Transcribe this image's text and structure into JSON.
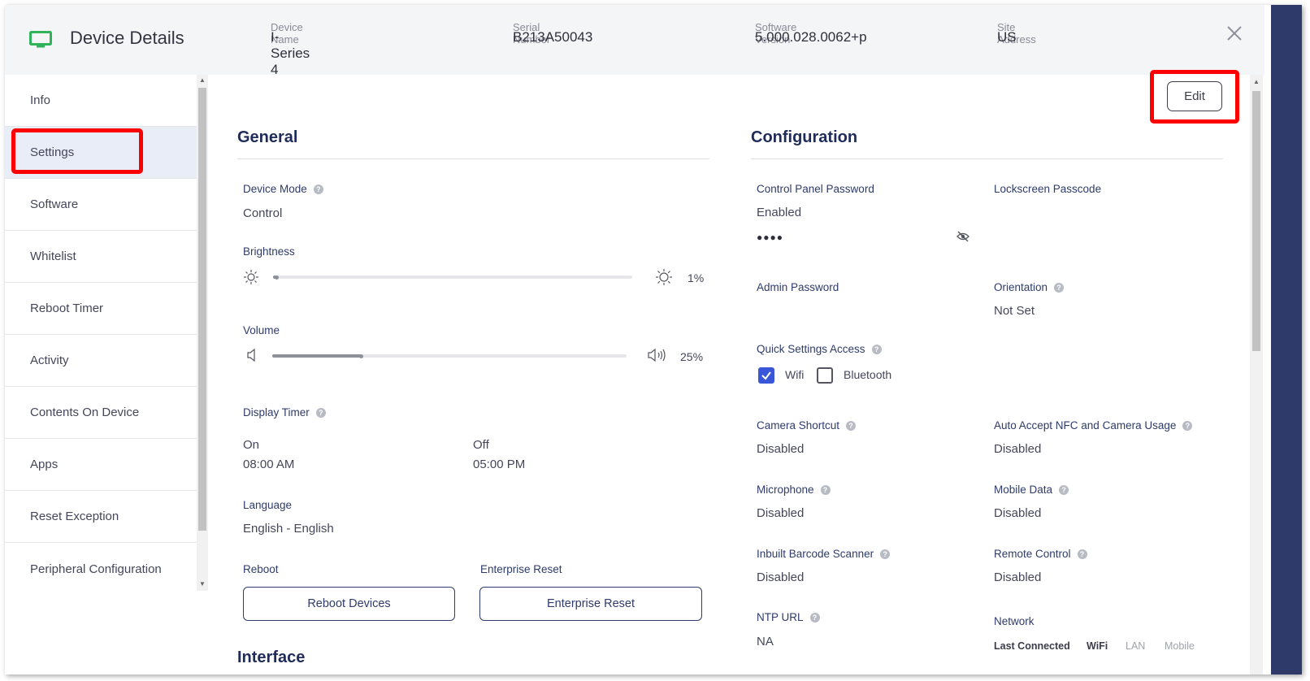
{
  "header": {
    "title": "Device Details",
    "fields": [
      {
        "label": "Device Name",
        "value": "I-Series 4"
      },
      {
        "label": "Serial Number",
        "value": "B213A50043"
      },
      {
        "label": "Software Version",
        "value": "5.000.028.0062+p"
      },
      {
        "label": "Site Address",
        "value": "US"
      }
    ]
  },
  "sidebar": {
    "items": [
      {
        "label": "Info"
      },
      {
        "label": "Settings",
        "active": true
      },
      {
        "label": "Software"
      },
      {
        "label": "Whitelist"
      },
      {
        "label": "Reboot Timer"
      },
      {
        "label": "Activity"
      },
      {
        "label": "Contents On Device"
      },
      {
        "label": "Apps"
      },
      {
        "label": "Reset Exception"
      },
      {
        "label": "Peripheral Configuration"
      }
    ]
  },
  "main": {
    "edit_label": "Edit",
    "general": {
      "title": "General",
      "device_mode": {
        "label": "Device Mode",
        "value": "Control"
      },
      "brightness": {
        "label": "Brightness",
        "value_text": "1%",
        "level": 0.01
      },
      "volume": {
        "label": "Volume",
        "value_text": "25%",
        "level": 0.25
      },
      "display_timer": {
        "label": "Display Timer",
        "on_label": "On",
        "on_value": "08:00 AM",
        "off_label": "Off",
        "off_value": "05:00 PM"
      },
      "language": {
        "label": "Language",
        "value": "English - English"
      },
      "reboot": {
        "label": "Reboot",
        "button": "Reboot Devices"
      },
      "enterprise_reset": {
        "label": "Enterprise Reset",
        "button": "Enterprise Reset"
      },
      "next_section_peek": "Interface"
    },
    "configuration": {
      "title": "Configuration",
      "control_panel_password": {
        "label": "Control Panel Password",
        "value": "Enabled",
        "masked": "●●●●"
      },
      "lockscreen_passcode": {
        "label": "Lockscreen Passcode"
      },
      "admin_password": {
        "label": "Admin Password"
      },
      "orientation": {
        "label": "Orientation",
        "value": "Not Set"
      },
      "quick_settings": {
        "label": "Quick Settings Access",
        "options": [
          {
            "label": "Wifi",
            "checked": true
          },
          {
            "label": "Bluetooth",
            "checked": false
          }
        ]
      },
      "camera_shortcut": {
        "label": "Camera Shortcut",
        "value": "Disabled"
      },
      "auto_accept_nfc": {
        "label": "Auto Accept NFC and Camera Usage",
        "value": "Disabled"
      },
      "microphone": {
        "label": "Microphone",
        "value": "Disabled"
      },
      "mobile_data": {
        "label": "Mobile Data",
        "value": "Disabled"
      },
      "barcode_scanner": {
        "label": "Inbuilt Barcode Scanner",
        "value": "Disabled"
      },
      "remote_control": {
        "label": "Remote Control",
        "value": "Disabled"
      },
      "ntp_url": {
        "label": "NTP URL",
        "value": "NA"
      },
      "network": {
        "label": "Network",
        "tabs": [
          {
            "label": "Last Connected",
            "bold": true
          },
          {
            "label": "WiFi",
            "bold": true
          },
          {
            "label": "LAN",
            "bold": false
          },
          {
            "label": "Mobile",
            "bold": false
          }
        ]
      }
    }
  },
  "colors": {
    "accent_navy": "#1f2b5a",
    "highlight_red": "#ff0000",
    "checkbox_blue": "#3a56d8",
    "monitor_green": "#2fb35a",
    "active_bg": "#e9edf8"
  },
  "icons": [
    "monitor-icon",
    "close-icon",
    "help-icon",
    "sun-icon",
    "speaker-icon",
    "speaker-loud-icon",
    "eye-off-icon",
    "check-icon"
  ]
}
